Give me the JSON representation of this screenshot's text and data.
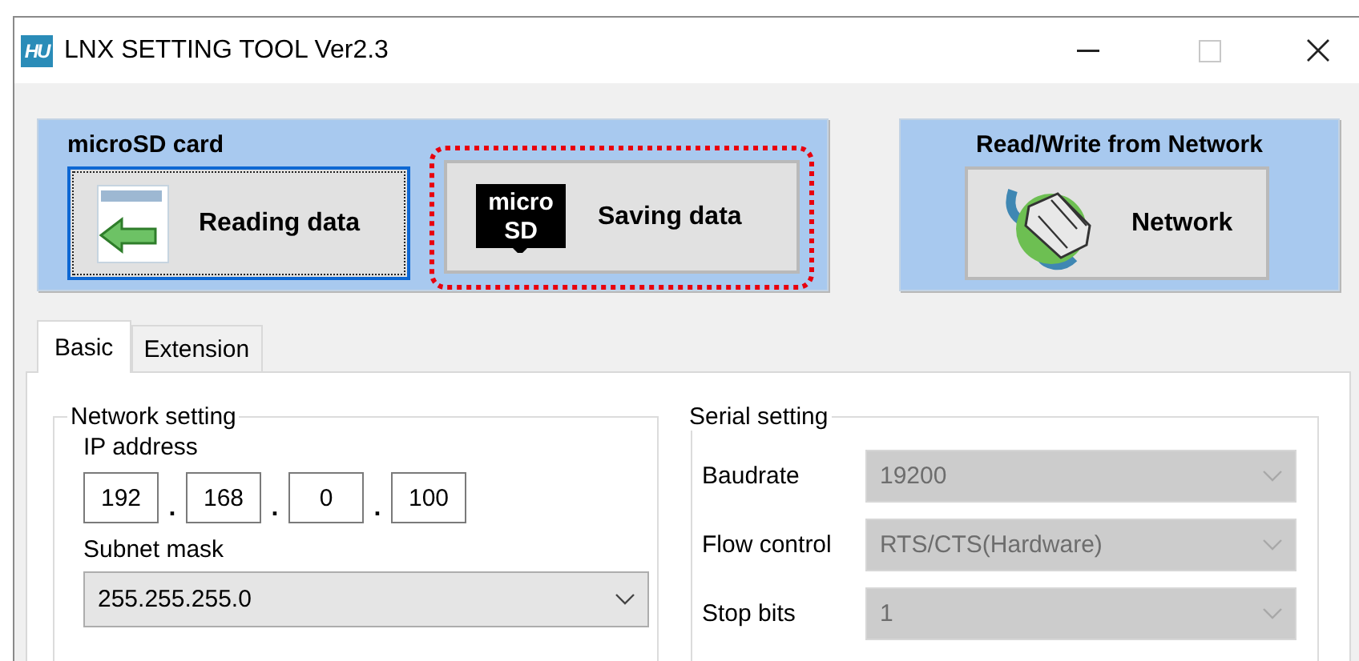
{
  "window": {
    "logo_text": "HU",
    "title": "LNX SETTING TOOL Ver2.3"
  },
  "panels": [
    {
      "title": "microSD card",
      "buttons": [
        {
          "label": "Reading data",
          "kind": "reading",
          "focused": true,
          "highlighted": false
        },
        {
          "label": "Saving data",
          "kind": "microsd",
          "icon_text": [
            "micro",
            "SD"
          ],
          "focused": false,
          "highlighted": true
        }
      ]
    },
    {
      "title": "Read/Write from Network",
      "buttons": [
        {
          "label": "Network",
          "kind": "network",
          "focused": false,
          "highlighted": false
        }
      ]
    }
  ],
  "tabs": [
    {
      "label": "Basic",
      "selected": true
    },
    {
      "label": "Extension",
      "selected": false
    }
  ],
  "network_setting": {
    "title": "Network setting",
    "ip_label": "IP address",
    "ip_octets": [
      "192",
      "168",
      "0",
      "100"
    ],
    "ip_separators": [
      ".",
      ".",
      "."
    ],
    "subnet_label": "Subnet mask",
    "subnet_value": "255.255.255.0",
    "subnet_disabled": false
  },
  "serial_setting": {
    "title": "Serial setting",
    "rows": [
      {
        "label": "Baudrate",
        "value": "19200",
        "disabled": true
      },
      {
        "label": "Flow control",
        "value": "RTS/CTS(Hardware)",
        "disabled": true
      },
      {
        "label": "Stop bits",
        "value": "1",
        "disabled": true
      }
    ]
  }
}
